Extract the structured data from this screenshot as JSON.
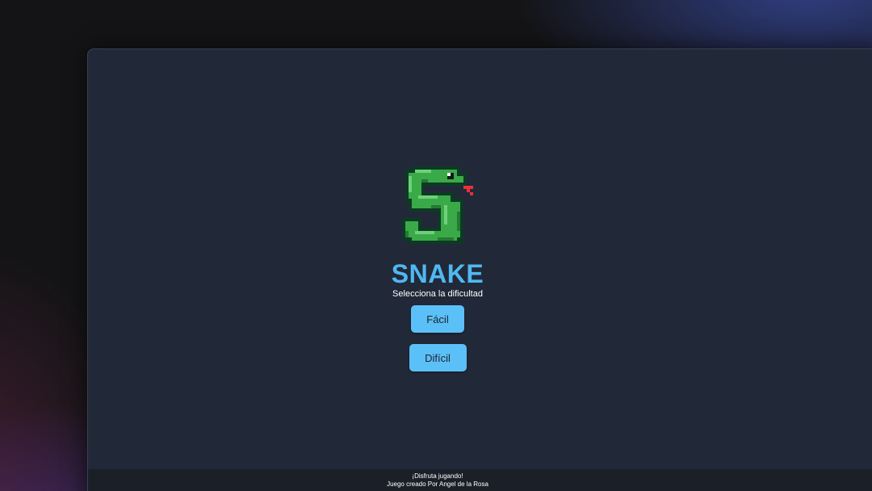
{
  "app": {
    "logo_icon": "pixel-snake-icon",
    "title": "SNAKE",
    "subtitle": "Selecciona la dificultad"
  },
  "difficulty": {
    "easy_label": "Fácil",
    "hard_label": "Difícil"
  },
  "footer": {
    "line1": "¡Disfruta jugando!",
    "line2": "Juego creado Por Angel de la Rosa"
  },
  "colors": {
    "background": "#212838",
    "title": "#4fb8f2",
    "button": "#5bc0f7",
    "snake_green": "#3aaa48",
    "snake_outline": "#0d3a24",
    "tongue": "#e8323a"
  }
}
